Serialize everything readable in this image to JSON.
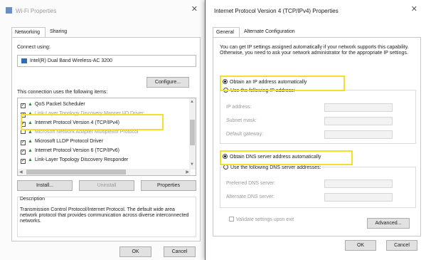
{
  "left_window": {
    "title": "Wi-Fi Properties",
    "tabs": [
      "Networking",
      "Sharing"
    ],
    "connect_using_label": "Connect using:",
    "adapter_name": "Intel(R) Dual Band Wireless-AC 3200",
    "configure_button": "Configure...",
    "items_label": "This connection uses the following items:",
    "items": [
      {
        "label": "QoS Packet Scheduler",
        "checked": true
      },
      {
        "label": "Link-Layer Topology Discovery Mapper I/O Driver",
        "checked": true
      },
      {
        "label": "Internet Protocol Version 4 (TCP/IPv4)",
        "checked": true
      },
      {
        "label": "Microsoft Network Adapter Multiplexor Protocol",
        "checked": false
      },
      {
        "label": "Microsoft LLDP Protocol Driver",
        "checked": true
      },
      {
        "label": "Internet Protocol Version 6 (TCP/IPv6)",
        "checked": true
      },
      {
        "label": "Link-Layer Topology Discovery Responder",
        "checked": true
      }
    ],
    "install_button": "Install...",
    "uninstall_button": "Uninstall",
    "properties_button": "Properties",
    "description_label": "Description",
    "description_text": "Transmission Control Protocol/Internet Protocol. The default wide area network protocol that provides communication across diverse interconnected networks.",
    "ok_button": "OK",
    "cancel_button": "Cancel"
  },
  "right_window": {
    "title": "Internet Protocol Version 4 (TCP/IPv4) Properties",
    "tabs": [
      "General",
      "Alternate Configuration"
    ],
    "intro_text": "You can get IP settings assigned automatically if your network supports this capability. Otherwise, you need to ask your network administrator for the appropriate IP settings.",
    "ip_auto_label": "Obtain an IP address automatically",
    "ip_manual_label": "Use the following IP address:",
    "ip_address_label": "IP address:",
    "subnet_mask_label": "Subnet mask:",
    "default_gateway_label": "Default gateway:",
    "dns_auto_label": "Obtain DNS server address automatically",
    "dns_manual_label": "Use the following DNS server addresses:",
    "preferred_dns_label": "Preferred DNS server:",
    "alternate_dns_label": "Alternate DNS server:",
    "validate_label": "Validate settings upon exit",
    "advanced_button": "Advanced...",
    "ok_button": "OK",
    "cancel_button": "Cancel"
  },
  "colors": {
    "highlight": "#f2e02a",
    "adapter_icon": "#2c6fb7"
  }
}
